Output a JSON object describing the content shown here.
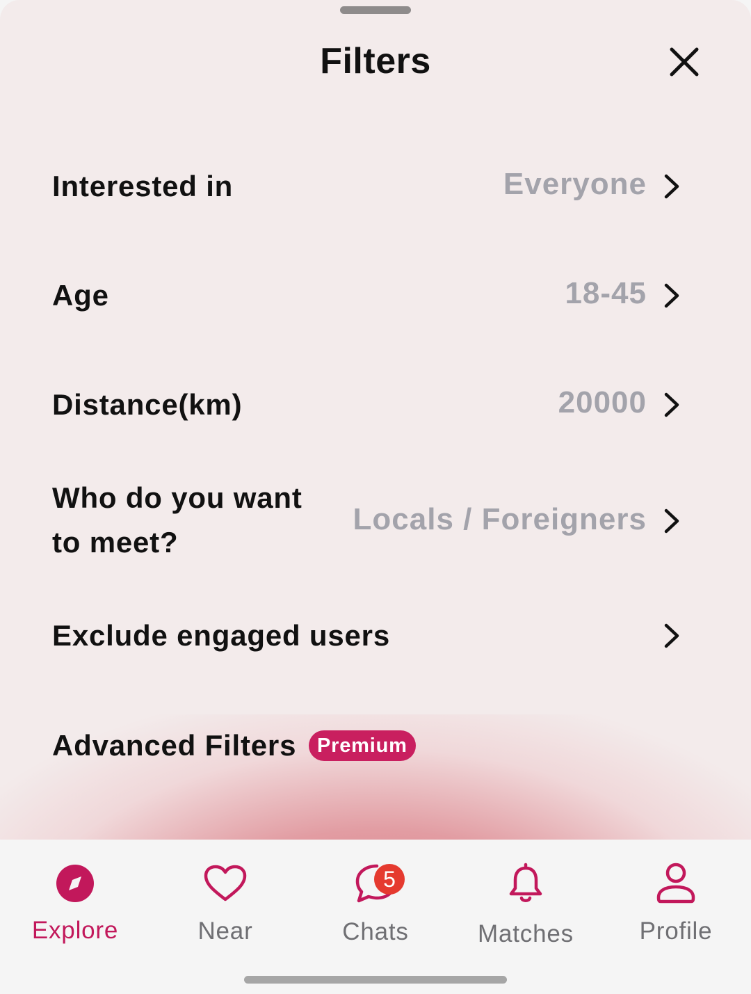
{
  "sheet": {
    "title": "Filters"
  },
  "filters": [
    {
      "label": "Interested in",
      "value": "Everyone"
    },
    {
      "label": "Age",
      "value": "18-45"
    },
    {
      "label": "Distance(km)",
      "value": "20000"
    },
    {
      "label_line1": "Who do you want",
      "label_line2": "to meet?",
      "value": "Locals / Foreigners"
    },
    {
      "label": "Exclude engaged users",
      "value": ""
    }
  ],
  "advanced": {
    "label": "Advanced Filters",
    "badge": "Premium"
  },
  "bottom_nav": {
    "items": [
      {
        "label": "Explore",
        "icon": "compass-icon",
        "active": true
      },
      {
        "label": "Near",
        "icon": "heart-icon",
        "active": false
      },
      {
        "label": "Chats",
        "icon": "chat-bubble-icon",
        "active": false,
        "badge": "5"
      },
      {
        "label": "Matches",
        "icon": "bell-icon",
        "active": false
      },
      {
        "label": "Profile",
        "icon": "person-icon",
        "active": false
      }
    ]
  },
  "colors": {
    "accent": "#c2185b",
    "badge": "#c91f5f",
    "notification": "#e53a2f",
    "value_text": "#a3a3ab",
    "sheet_bg": "#f3ebeb"
  }
}
